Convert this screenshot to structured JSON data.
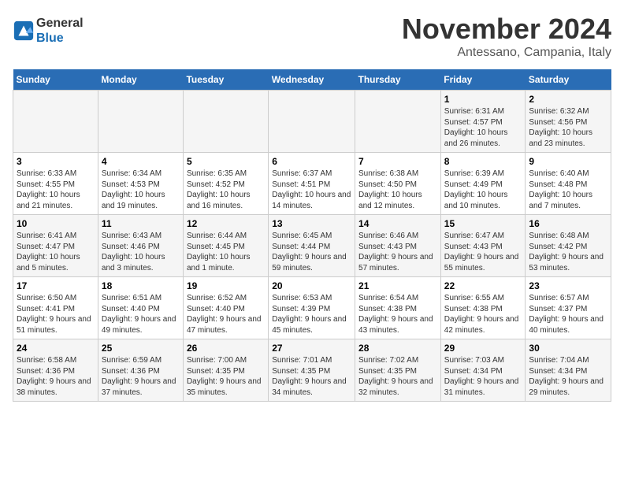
{
  "logo": {
    "line1": "General",
    "line2": "Blue"
  },
  "title": "November 2024",
  "subtitle": "Antessano, Campania, Italy",
  "days_of_week": [
    "Sunday",
    "Monday",
    "Tuesday",
    "Wednesday",
    "Thursday",
    "Friday",
    "Saturday"
  ],
  "weeks": [
    {
      "cells": [
        {
          "day": "",
          "info": ""
        },
        {
          "day": "",
          "info": ""
        },
        {
          "day": "",
          "info": ""
        },
        {
          "day": "",
          "info": ""
        },
        {
          "day": "",
          "info": ""
        },
        {
          "day": "1",
          "info": "Sunrise: 6:31 AM\nSunset: 4:57 PM\nDaylight: 10 hours and 26 minutes."
        },
        {
          "day": "2",
          "info": "Sunrise: 6:32 AM\nSunset: 4:56 PM\nDaylight: 10 hours and 23 minutes."
        }
      ]
    },
    {
      "cells": [
        {
          "day": "3",
          "info": "Sunrise: 6:33 AM\nSunset: 4:55 PM\nDaylight: 10 hours and 21 minutes."
        },
        {
          "day": "4",
          "info": "Sunrise: 6:34 AM\nSunset: 4:53 PM\nDaylight: 10 hours and 19 minutes."
        },
        {
          "day": "5",
          "info": "Sunrise: 6:35 AM\nSunset: 4:52 PM\nDaylight: 10 hours and 16 minutes."
        },
        {
          "day": "6",
          "info": "Sunrise: 6:37 AM\nSunset: 4:51 PM\nDaylight: 10 hours and 14 minutes."
        },
        {
          "day": "7",
          "info": "Sunrise: 6:38 AM\nSunset: 4:50 PM\nDaylight: 10 hours and 12 minutes."
        },
        {
          "day": "8",
          "info": "Sunrise: 6:39 AM\nSunset: 4:49 PM\nDaylight: 10 hours and 10 minutes."
        },
        {
          "day": "9",
          "info": "Sunrise: 6:40 AM\nSunset: 4:48 PM\nDaylight: 10 hours and 7 minutes."
        }
      ]
    },
    {
      "cells": [
        {
          "day": "10",
          "info": "Sunrise: 6:41 AM\nSunset: 4:47 PM\nDaylight: 10 hours and 5 minutes."
        },
        {
          "day": "11",
          "info": "Sunrise: 6:43 AM\nSunset: 4:46 PM\nDaylight: 10 hours and 3 minutes."
        },
        {
          "day": "12",
          "info": "Sunrise: 6:44 AM\nSunset: 4:45 PM\nDaylight: 10 hours and 1 minute."
        },
        {
          "day": "13",
          "info": "Sunrise: 6:45 AM\nSunset: 4:44 PM\nDaylight: 9 hours and 59 minutes."
        },
        {
          "day": "14",
          "info": "Sunrise: 6:46 AM\nSunset: 4:43 PM\nDaylight: 9 hours and 57 minutes."
        },
        {
          "day": "15",
          "info": "Sunrise: 6:47 AM\nSunset: 4:43 PM\nDaylight: 9 hours and 55 minutes."
        },
        {
          "day": "16",
          "info": "Sunrise: 6:48 AM\nSunset: 4:42 PM\nDaylight: 9 hours and 53 minutes."
        }
      ]
    },
    {
      "cells": [
        {
          "day": "17",
          "info": "Sunrise: 6:50 AM\nSunset: 4:41 PM\nDaylight: 9 hours and 51 minutes."
        },
        {
          "day": "18",
          "info": "Sunrise: 6:51 AM\nSunset: 4:40 PM\nDaylight: 9 hours and 49 minutes."
        },
        {
          "day": "19",
          "info": "Sunrise: 6:52 AM\nSunset: 4:40 PM\nDaylight: 9 hours and 47 minutes."
        },
        {
          "day": "20",
          "info": "Sunrise: 6:53 AM\nSunset: 4:39 PM\nDaylight: 9 hours and 45 minutes."
        },
        {
          "day": "21",
          "info": "Sunrise: 6:54 AM\nSunset: 4:38 PM\nDaylight: 9 hours and 43 minutes."
        },
        {
          "day": "22",
          "info": "Sunrise: 6:55 AM\nSunset: 4:38 PM\nDaylight: 9 hours and 42 minutes."
        },
        {
          "day": "23",
          "info": "Sunrise: 6:57 AM\nSunset: 4:37 PM\nDaylight: 9 hours and 40 minutes."
        }
      ]
    },
    {
      "cells": [
        {
          "day": "24",
          "info": "Sunrise: 6:58 AM\nSunset: 4:36 PM\nDaylight: 9 hours and 38 minutes."
        },
        {
          "day": "25",
          "info": "Sunrise: 6:59 AM\nSunset: 4:36 PM\nDaylight: 9 hours and 37 minutes."
        },
        {
          "day": "26",
          "info": "Sunrise: 7:00 AM\nSunset: 4:35 PM\nDaylight: 9 hours and 35 minutes."
        },
        {
          "day": "27",
          "info": "Sunrise: 7:01 AM\nSunset: 4:35 PM\nDaylight: 9 hours and 34 minutes."
        },
        {
          "day": "28",
          "info": "Sunrise: 7:02 AM\nSunset: 4:35 PM\nDaylight: 9 hours and 32 minutes."
        },
        {
          "day": "29",
          "info": "Sunrise: 7:03 AM\nSunset: 4:34 PM\nDaylight: 9 hours and 31 minutes."
        },
        {
          "day": "30",
          "info": "Sunrise: 7:04 AM\nSunset: 4:34 PM\nDaylight: 9 hours and 29 minutes."
        }
      ]
    }
  ]
}
